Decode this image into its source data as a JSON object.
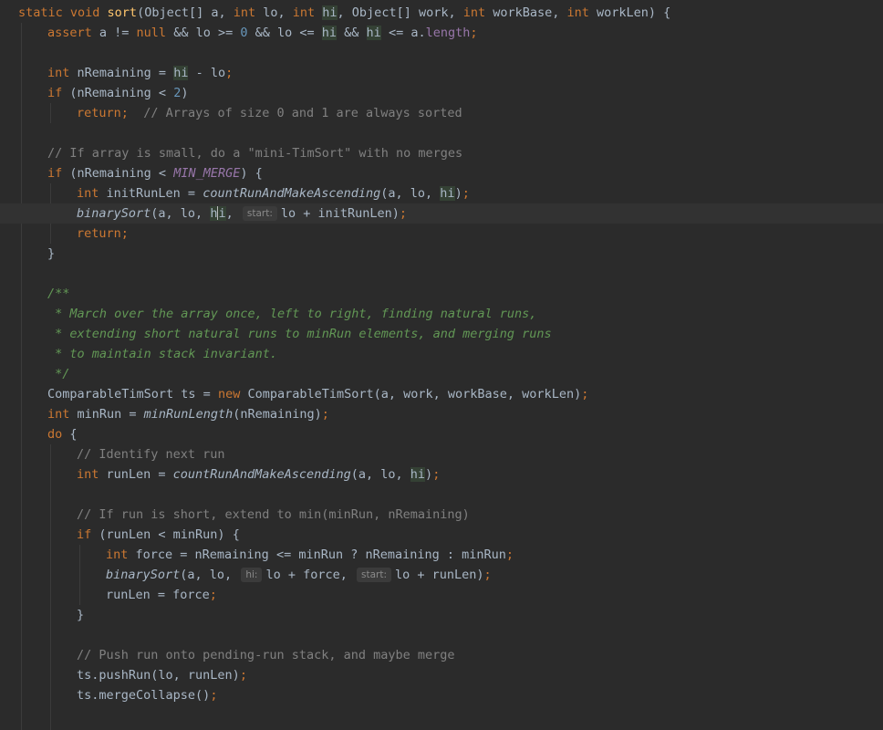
{
  "colors": {
    "background": "#2b2b2b",
    "current_line": "#323232",
    "keyword": "#cc7832",
    "function": "#ffc66d",
    "identifier": "#a9b7c6",
    "number": "#6897bb",
    "comment": "#808080",
    "doc_comment": "#629755",
    "field": "#9876aa",
    "highlight": "#344134",
    "hint_bg": "#3b3b3b"
  },
  "editor": {
    "current_line": 10,
    "lines": [
      {
        "indent": 0,
        "tokens": [
          [
            "kw",
            "static "
          ],
          [
            "kw",
            "void "
          ],
          [
            "fn",
            "sort"
          ],
          [
            "p",
            "(Object[] a, "
          ],
          [
            "kw",
            "int "
          ],
          [
            "p",
            "lo, "
          ],
          [
            "kw",
            "int "
          ],
          [
            "hl",
            "hi"
          ],
          [
            "p",
            ", Object[] work, "
          ],
          [
            "kw",
            "int "
          ],
          [
            "p",
            "workBase, "
          ],
          [
            "kw",
            "int "
          ],
          [
            "p",
            "workLen) {"
          ]
        ]
      },
      {
        "indent": 1,
        "tokens": [
          [
            "kw",
            "assert "
          ],
          [
            "p",
            "a != "
          ],
          [
            "kw",
            "null "
          ],
          [
            "p",
            "&& lo >= "
          ],
          [
            "num",
            "0 "
          ],
          [
            "p",
            "&& lo <= "
          ],
          [
            "hl",
            "hi"
          ],
          [
            "p",
            " && "
          ],
          [
            "hl",
            "hi"
          ],
          [
            "p",
            " <= a."
          ],
          [
            "field",
            "length"
          ],
          [
            "kw",
            ";"
          ]
        ]
      },
      {
        "indent": 1,
        "tokens": []
      },
      {
        "indent": 1,
        "tokens": [
          [
            "kw",
            "int "
          ],
          [
            "p",
            "nRemaining = "
          ],
          [
            "hl",
            "hi"
          ],
          [
            "p",
            " - lo"
          ],
          [
            "kw",
            ";"
          ]
        ]
      },
      {
        "indent": 1,
        "tokens": [
          [
            "kw",
            "if "
          ],
          [
            "p",
            "(nRemaining < "
          ],
          [
            "num",
            "2"
          ],
          [
            "p",
            ")"
          ]
        ]
      },
      {
        "indent": 2,
        "tokens": [
          [
            "kw",
            "return"
          ],
          [
            "kw",
            ";"
          ],
          [
            "p",
            "  "
          ],
          [
            "cmt",
            "// Arrays of size 0 and 1 are always sorted"
          ]
        ]
      },
      {
        "indent": 1,
        "tokens": []
      },
      {
        "indent": 1,
        "tokens": [
          [
            "cmt",
            "// If array is small, do a \"mini-TimSort\" with no merges"
          ]
        ]
      },
      {
        "indent": 1,
        "tokens": [
          [
            "kw",
            "if "
          ],
          [
            "p",
            "(nRemaining < "
          ],
          [
            "const",
            "MIN_MERGE"
          ],
          [
            "p",
            ") {"
          ]
        ]
      },
      {
        "indent": 2,
        "tokens": [
          [
            "kw",
            "int "
          ],
          [
            "p",
            "initRunLen = "
          ],
          [
            "ital",
            "countRunAndMakeAscending"
          ],
          [
            "p",
            "(a, lo, "
          ],
          [
            "hl",
            "hi"
          ],
          [
            "p",
            ")"
          ],
          [
            "kw",
            ";"
          ]
        ]
      },
      {
        "indent": 2,
        "tokens": [
          [
            "ital",
            "binarySort"
          ],
          [
            "p",
            "(a, lo, "
          ],
          [
            "hlc",
            "h|i"
          ],
          [
            "p",
            ", "
          ],
          [
            "hint",
            "start:"
          ],
          [
            "p",
            "lo + initRunLen)"
          ],
          [
            "kw",
            ";"
          ]
        ]
      },
      {
        "indent": 2,
        "tokens": [
          [
            "kw",
            "return"
          ],
          [
            "kw",
            ";"
          ]
        ]
      },
      {
        "indent": 1,
        "tokens": [
          [
            "p",
            "}"
          ]
        ]
      },
      {
        "indent": 1,
        "tokens": []
      },
      {
        "indent": 1,
        "tokens": [
          [
            "doc",
            "/**"
          ]
        ]
      },
      {
        "indent": 1,
        "tokens": [
          [
            "doc",
            " * March over the array once, left to right, finding natural runs,"
          ]
        ]
      },
      {
        "indent": 1,
        "tokens": [
          [
            "doc",
            " * extending short natural runs to minRun elements, and merging runs"
          ]
        ]
      },
      {
        "indent": 1,
        "tokens": [
          [
            "doc",
            " * to maintain stack invariant."
          ]
        ]
      },
      {
        "indent": 1,
        "tokens": [
          [
            "doc",
            " */"
          ]
        ]
      },
      {
        "indent": 1,
        "tokens": [
          [
            "p",
            "ComparableTimSort ts = "
          ],
          [
            "kw",
            "new "
          ],
          [
            "p",
            "ComparableTimSort(a, work, workBase, workLen)"
          ],
          [
            "kw",
            ";"
          ]
        ]
      },
      {
        "indent": 1,
        "tokens": [
          [
            "kw",
            "int "
          ],
          [
            "p",
            "minRun = "
          ],
          [
            "ital",
            "minRunLength"
          ],
          [
            "p",
            "(nRemaining)"
          ],
          [
            "kw",
            ";"
          ]
        ]
      },
      {
        "indent": 1,
        "tokens": [
          [
            "kw",
            "do "
          ],
          [
            "p",
            "{"
          ]
        ]
      },
      {
        "indent": 2,
        "tokens": [
          [
            "cmt",
            "// Identify next run"
          ]
        ]
      },
      {
        "indent": 2,
        "tokens": [
          [
            "kw",
            "int "
          ],
          [
            "p",
            "runLen = "
          ],
          [
            "ital",
            "countRunAndMakeAscending"
          ],
          [
            "p",
            "(a, lo, "
          ],
          [
            "hl",
            "hi"
          ],
          [
            "p",
            ")"
          ],
          [
            "kw",
            ";"
          ]
        ]
      },
      {
        "indent": 2,
        "tokens": []
      },
      {
        "indent": 2,
        "tokens": [
          [
            "cmt",
            "// If run is short, extend to min(minRun, nRemaining)"
          ]
        ]
      },
      {
        "indent": 2,
        "tokens": [
          [
            "kw",
            "if "
          ],
          [
            "p",
            "(runLen < minRun) {"
          ]
        ]
      },
      {
        "indent": 3,
        "tokens": [
          [
            "kw",
            "int "
          ],
          [
            "p",
            "force = nRemaining <= minRun ? nRemaining : minRun"
          ],
          [
            "kw",
            ";"
          ]
        ]
      },
      {
        "indent": 3,
        "tokens": [
          [
            "ital",
            "binarySort"
          ],
          [
            "p",
            "(a, lo, "
          ],
          [
            "hint",
            "hi:"
          ],
          [
            "p",
            "lo + force, "
          ],
          [
            "hint",
            "start:"
          ],
          [
            "p",
            "lo + runLen)"
          ],
          [
            "kw",
            ";"
          ]
        ]
      },
      {
        "indent": 3,
        "tokens": [
          [
            "p",
            "runLen = force"
          ],
          [
            "kw",
            ";"
          ]
        ]
      },
      {
        "indent": 2,
        "tokens": [
          [
            "p",
            "}"
          ]
        ]
      },
      {
        "indent": 2,
        "tokens": []
      },
      {
        "indent": 2,
        "tokens": [
          [
            "cmt",
            "// Push run onto pending-run stack, and maybe merge"
          ]
        ]
      },
      {
        "indent": 2,
        "tokens": [
          [
            "p",
            "ts.pushRun(lo, runLen)"
          ],
          [
            "kw",
            ";"
          ]
        ]
      },
      {
        "indent": 2,
        "tokens": [
          [
            "p",
            "ts.mergeCollapse()"
          ],
          [
            "kw",
            ";"
          ]
        ]
      },
      {
        "indent": 2,
        "tokens": []
      },
      {
        "indent": 2,
        "tokens": [
          [
            "cmt",
            "//"
          ]
        ]
      }
    ]
  }
}
